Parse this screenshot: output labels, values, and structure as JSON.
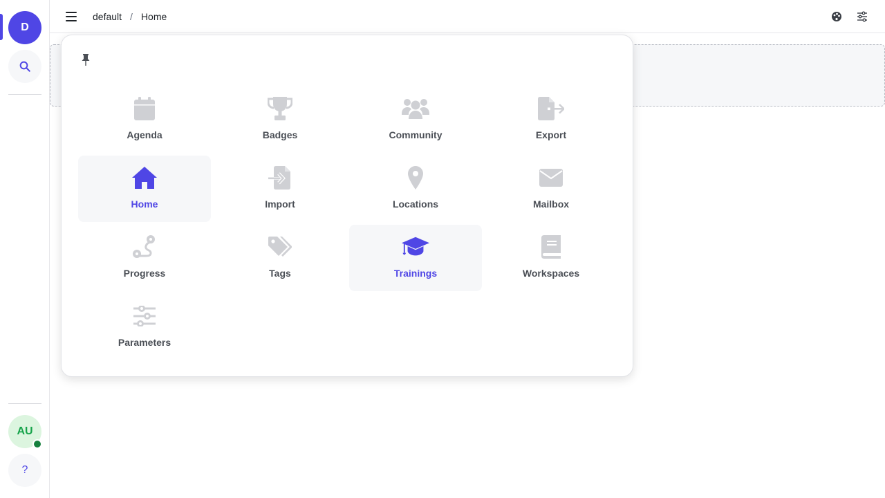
{
  "workspace": {
    "initial": "D"
  },
  "user": {
    "initials": "AU"
  },
  "help": {
    "label": "?"
  },
  "breadcrumb": {
    "workspace": "default",
    "separator": "/",
    "page": "Home"
  },
  "colors": {
    "accent": "#4f46e5",
    "inactive_icon": "#cfd0d4",
    "active_bg": "#f6f7f9",
    "online": "#15803d"
  },
  "apps": [
    {
      "label": "Agenda",
      "icon": "calendar-icon"
    },
    {
      "label": "Badges",
      "icon": "trophy-icon"
    },
    {
      "label": "Community",
      "icon": "users-icon"
    },
    {
      "label": "Export",
      "icon": "file-export-icon"
    },
    {
      "label": "Home",
      "icon": "home-icon",
      "active": true
    },
    {
      "label": "Import",
      "icon": "file-import-icon"
    },
    {
      "label": "Locations",
      "icon": "map-pin-icon"
    },
    {
      "label": "Mailbox",
      "icon": "envelope-icon"
    },
    {
      "label": "Progress",
      "icon": "route-icon"
    },
    {
      "label": "Tags",
      "icon": "tags-icon"
    },
    {
      "label": "Trainings",
      "icon": "graduation-cap-icon",
      "active": true
    },
    {
      "label": "Workspaces",
      "icon": "book-icon"
    },
    {
      "label": "Parameters",
      "icon": "sliders-icon"
    }
  ]
}
